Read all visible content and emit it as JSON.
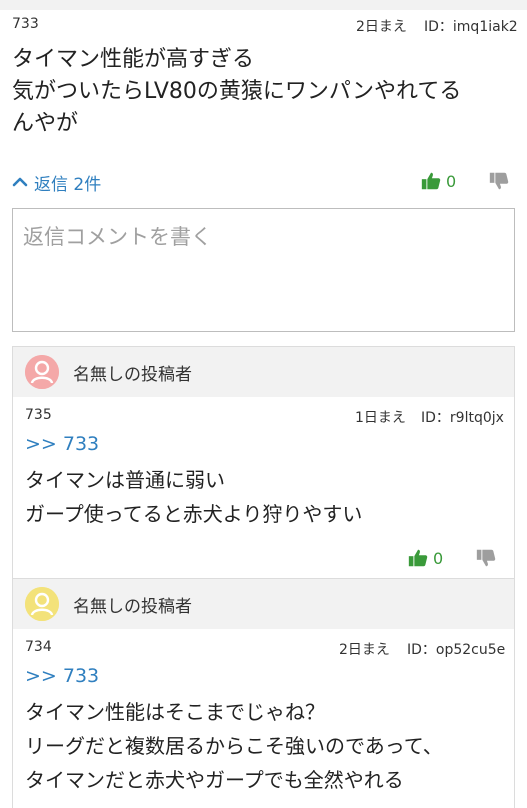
{
  "post": {
    "number": "733",
    "date": "2日まえ",
    "id": "ID：imq1iak2",
    "lines": "タイマン性能が高すぎる\n気がついたらLV80の黄猿にワンパンやれてる\nんやが",
    "reply_toggle": "返信 2件",
    "upvotes": "0"
  },
  "comment_input": {
    "placeholder": "返信コメントを書く"
  },
  "replies": [
    {
      "author": "名無しの投稿者",
      "number": "735",
      "date": "1日まえ",
      "id": "ID：r9ltq0jx",
      "anchor": ">> 733",
      "text": "タイマンは普通に弱い\nガープ使ってると赤犬より狩りやすい",
      "upvotes": "0",
      "avatar_color": "#f4a8a8"
    },
    {
      "author": "名無しの投稿者",
      "number": "734",
      "date": "2日まえ",
      "id": "ID：op52cu5e",
      "anchor": ">> 733",
      "text": "タイマン性能はそこまでじゃね？\nリーグだと複数居るからこそ強いのであって、\nタイマンだと赤犬やガープでも全然やれる",
      "avatar_color": "#f3e27a"
    }
  ],
  "colors": {
    "link": "#2f7fbf",
    "upvote": "#3a9a3a",
    "downvote": "#9e9e9e"
  },
  "icons": [
    "chevron-up-icon",
    "thumbs-up-icon",
    "thumbs-down-icon",
    "user-avatar-icon"
  ]
}
